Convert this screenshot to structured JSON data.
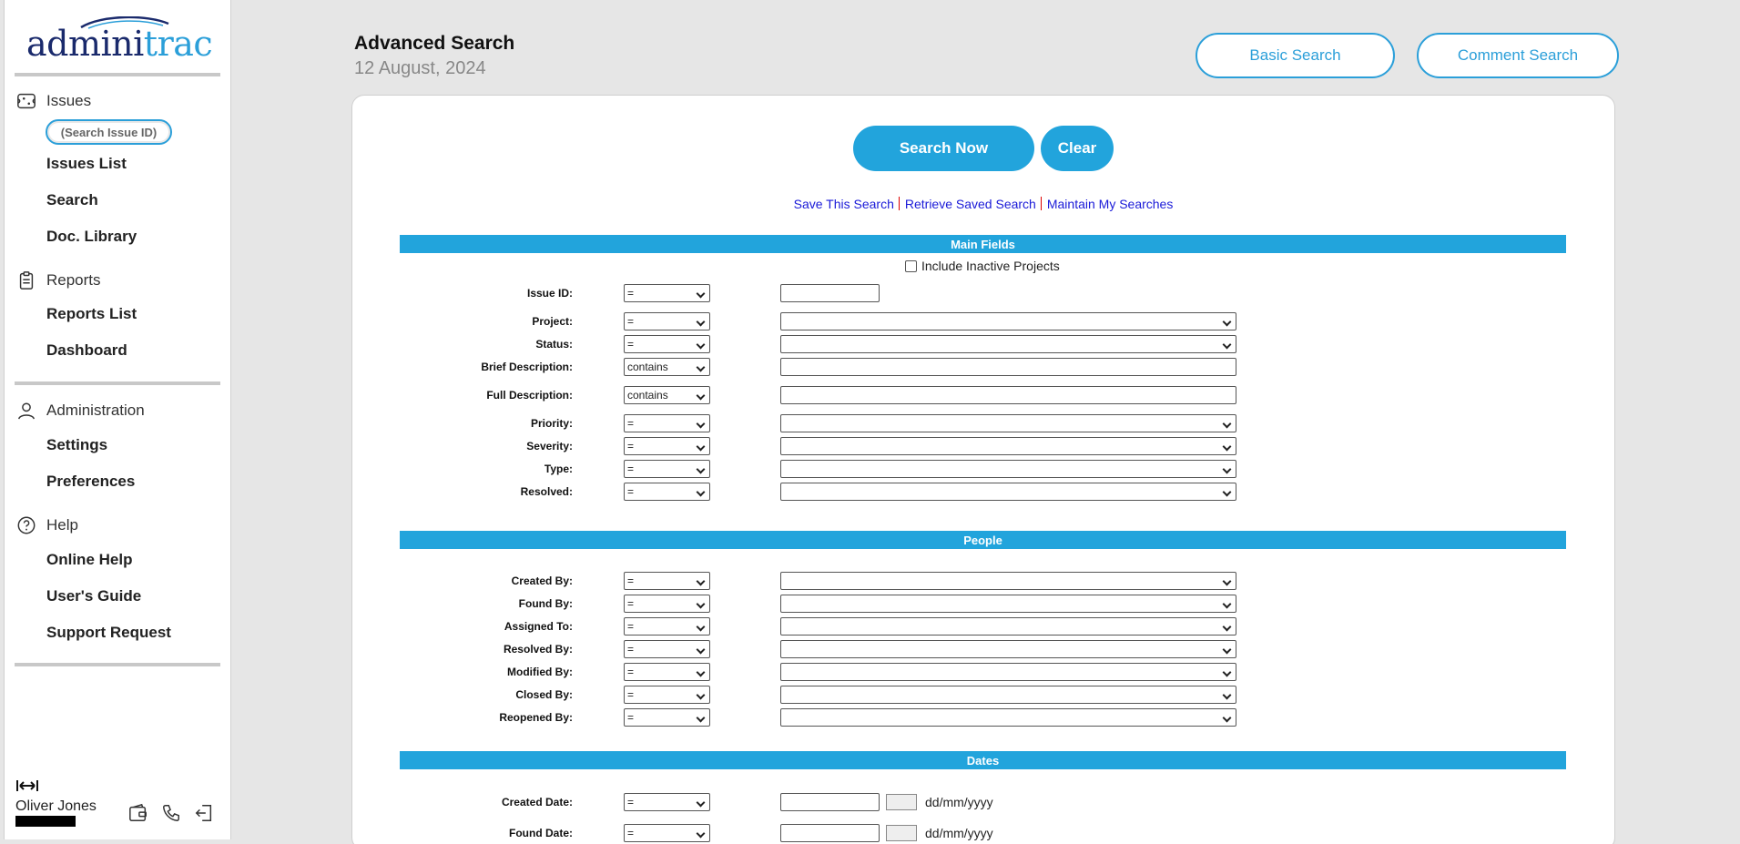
{
  "brand": {
    "logo_admini": "admini",
    "logo_trac": "trac"
  },
  "sidebar": {
    "issues_label": "Issues",
    "search_issue_id": "(Search Issue ID)",
    "issues_items": [
      "Issues List",
      "Search",
      "Doc. Library"
    ],
    "reports_label": "Reports",
    "reports_items": [
      "Reports List",
      "Dashboard"
    ],
    "admin_label": "Administration",
    "admin_items": [
      "Settings",
      "Preferences"
    ],
    "help_label": "Help",
    "help_items": [
      "Online Help",
      "User's Guide",
      "Support Request"
    ],
    "user_name": "Oliver Jones"
  },
  "header": {
    "title": "Advanced Search",
    "date": "12 August, 2024",
    "basic_search": "Basic Search",
    "comment_search": "Comment Search"
  },
  "actions": {
    "search_now": "Search Now",
    "clear": "Clear",
    "save_search": "Save This Search",
    "retrieve_search": "Retrieve Saved Search",
    "maintain_searches": "Maintain My Searches"
  },
  "sections": {
    "main": "Main Fields",
    "people": "People",
    "dates": "Dates"
  },
  "include_inactive": "Include Inactive Projects",
  "main_fields": [
    {
      "label": "Issue ID:",
      "op": "="
    },
    {
      "label": "Project:",
      "op": "="
    },
    {
      "label": "Status:",
      "op": "="
    },
    {
      "label": "Brief Description:",
      "op": "contains"
    },
    {
      "label": "Full Description:",
      "op": "contains"
    },
    {
      "label": "Priority:",
      "op": "="
    },
    {
      "label": "Severity:",
      "op": "="
    },
    {
      "label": "Type:",
      "op": "="
    },
    {
      "label": "Resolved:",
      "op": "="
    }
  ],
  "people_fields": [
    {
      "label": "Created By:",
      "op": "="
    },
    {
      "label": "Found By:",
      "op": "="
    },
    {
      "label": "Assigned To:",
      "op": "="
    },
    {
      "label": "Resolved By:",
      "op": "="
    },
    {
      "label": "Modified By:",
      "op": "="
    },
    {
      "label": "Closed By:",
      "op": "="
    },
    {
      "label": "Reopened By:",
      "op": "="
    }
  ],
  "date_fields": [
    {
      "label": "Created Date:",
      "op": "=",
      "format": "dd/mm/yyyy"
    },
    {
      "label": "Found Date:",
      "op": "=",
      "format": "dd/mm/yyyy"
    }
  ]
}
